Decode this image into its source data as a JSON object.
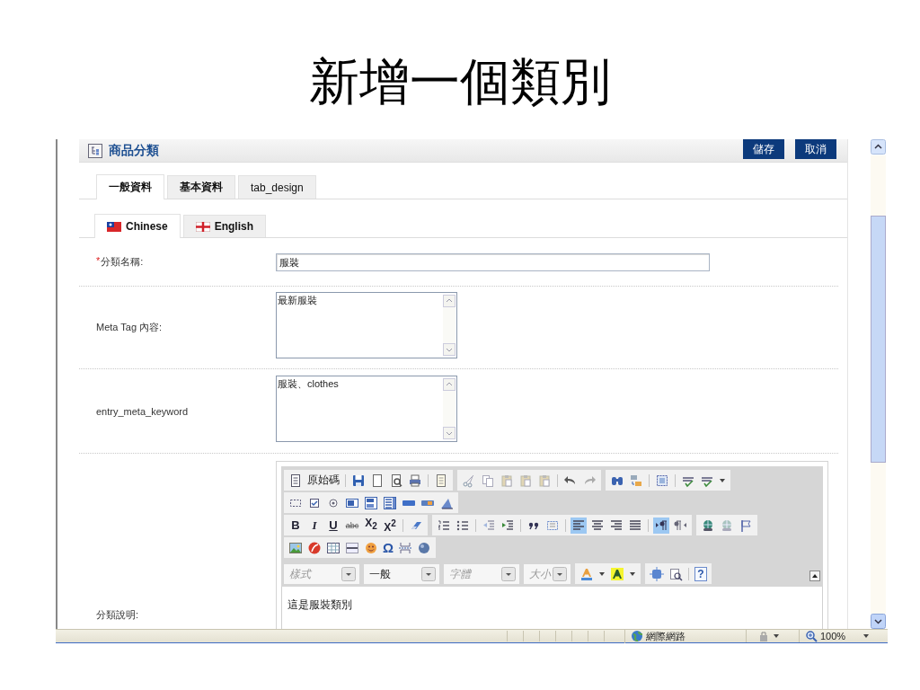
{
  "slide": {
    "title": "新增一個類別"
  },
  "panel": {
    "title": "商品分類",
    "buttons": [
      "儲存",
      "取消"
    ]
  },
  "tabs": [
    {
      "label": "一般資料",
      "selected": true
    },
    {
      "label": "基本資料",
      "selected": false
    },
    {
      "label": "tab_design",
      "selected": false
    }
  ],
  "language_tabs": [
    {
      "label": "Chinese",
      "selected": true
    },
    {
      "label": "English",
      "selected": false
    }
  ],
  "fields": [
    {
      "kind": "text",
      "required_mark": "*",
      "label": "分類名稱:",
      "value": "服裝"
    },
    {
      "kind": "textarea",
      "label": "Meta Tag 內容:",
      "value": "最新服裝"
    },
    {
      "kind": "textarea",
      "label": "entry_meta_keyword",
      "value": "服裝、clothes"
    },
    {
      "kind": "editor",
      "label": "分類說明:",
      "value": "這是服裝類別"
    }
  ],
  "editor": {
    "source_label": "原始碼",
    "format_buttons": [
      {
        "label": "B",
        "kind": "bold"
      },
      {
        "label": "I",
        "kind": "italic"
      },
      {
        "label": "U",
        "kind": "underline"
      },
      {
        "label": "abc",
        "kind": "strike"
      },
      {
        "label": "X$_{2}$",
        "kind": "script"
      },
      {
        "label": "X$^{2}$",
        "kind": "script"
      }
    ],
    "alignment": [
      {
        "selected": true
      },
      {
        "selected": false
      },
      {
        "selected": false
      },
      {
        "selected": false
      }
    ],
    "direction": [
      {
        "selected": true
      },
      {
        "selected": false
      }
    ],
    "special_char": "Ω",
    "combos": [
      {
        "placeholder": "樣式"
      },
      {
        "value": "一般"
      },
      {
        "placeholder": "字體"
      },
      {
        "placeholder": "大小"
      }
    ],
    "help": "?"
  },
  "status_bar": {
    "zone": "網際網路",
    "zoom": "100%"
  }
}
